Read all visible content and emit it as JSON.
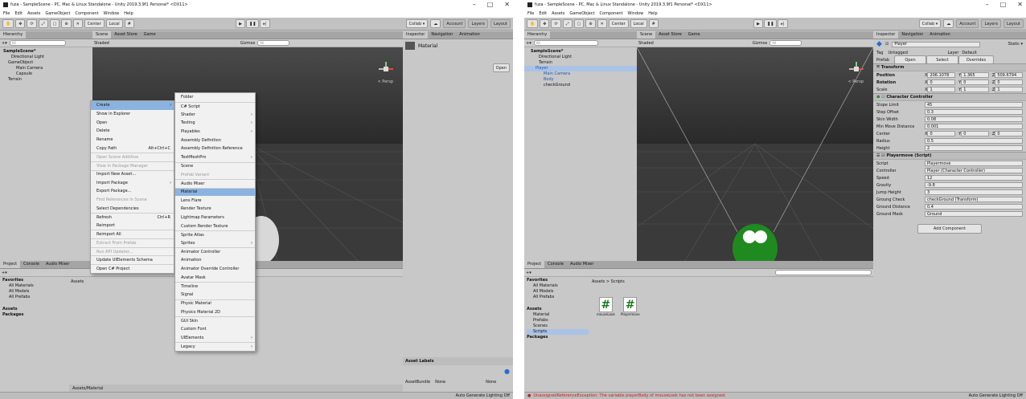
{
  "left": {
    "title": "fuza - SampleScene - PC, Mac & Linux Standalone - Unity 2019.3.9f1 Personal* <DX11>",
    "menu": [
      "File",
      "Edit",
      "Assets",
      "GameObject",
      "Component",
      "Window",
      "Help"
    ],
    "toolbar": {
      "center": "Center",
      "local": "Local",
      "collab": "Collab ▾",
      "account": "Account",
      "layers": "Layers",
      "layout": "Layout"
    },
    "hierarchy": {
      "tab": "Hierarchy",
      "search_placeholder": "All",
      "items": [
        "SampleScene*",
        "Directional Light",
        "GameObject",
        "Main Camera",
        "Capsule",
        "Terrain"
      ]
    },
    "scene": {
      "tabs": [
        "Scene",
        "Asset Store",
        "Game"
      ],
      "shading": "Shaded",
      "gizmos": "Gizmos",
      "search_placeholder": "All",
      "persp": "< Persp"
    },
    "inspector": {
      "tabs": [
        "Inspector",
        "Navigation",
        "Animation"
      ],
      "object_name": "Material",
      "open": "Open"
    },
    "context_menu": [
      {
        "label": "Create",
        "arrow": true,
        "hl": true
      },
      {
        "label": "Show in Explorer"
      },
      {
        "label": "Open"
      },
      {
        "label": "Delete"
      },
      {
        "label": "Rename"
      },
      {
        "label": "Copy Path",
        "shortcut": "Alt+Ctrl+C"
      },
      {
        "label": "Open Scene Additive",
        "dis": true,
        "sep": true
      },
      {
        "label": "View in Package Manager",
        "dis": true,
        "sep": true
      },
      {
        "label": "Import New Asset...",
        "sep": true
      },
      {
        "label": "Import Package",
        "arrow": true
      },
      {
        "label": "Export Package..."
      },
      {
        "label": "Find References In Scene",
        "dis": true
      },
      {
        "label": "Select Dependencies"
      },
      {
        "label": "Refresh",
        "shortcut": "Ctrl+R",
        "sep": true
      },
      {
        "label": "Reimport"
      },
      {
        "label": "Reimport All",
        "sep": true
      },
      {
        "label": "Extract From Prefab",
        "dis": true,
        "sep": true
      },
      {
        "label": "Run API Updater...",
        "dis": true,
        "sep": true
      },
      {
        "label": "Update UIElements Schema",
        "sep": true
      },
      {
        "label": "Open C# Project",
        "sep": true
      }
    ],
    "submenu": [
      {
        "label": "Folder"
      },
      {
        "label": "C# Script",
        "sep": true
      },
      {
        "label": "Shader",
        "arrow": true
      },
      {
        "label": "Testing",
        "arrow": true
      },
      {
        "label": "Playables",
        "arrow": true
      },
      {
        "label": "Assembly Definition"
      },
      {
        "label": "Assembly Definition Reference"
      },
      {
        "label": "TextMeshPro",
        "arrow": true
      },
      {
        "label": "Scene",
        "sep": true
      },
      {
        "label": "Prefab Variant",
        "dis": true
      },
      {
        "label": "Audio Mixer",
        "sep": true
      },
      {
        "label": "Material",
        "hl": true,
        "sep": true
      },
      {
        "label": "Lens Flare"
      },
      {
        "label": "Render Texture"
      },
      {
        "label": "Lightmap Parameters"
      },
      {
        "label": "Custom Render Texture"
      },
      {
        "label": "Sprite Atlas",
        "sep": true
      },
      {
        "label": "Sprites",
        "arrow": true
      },
      {
        "label": "Animator Controller",
        "sep": true
      },
      {
        "label": "Animation"
      },
      {
        "label": "Animator Override Controller"
      },
      {
        "label": "Avatar Mask"
      },
      {
        "label": "Timeline",
        "sep": true
      },
      {
        "label": "Signal"
      },
      {
        "label": "Physic Material",
        "sep": true
      },
      {
        "label": "Physics Material 2D"
      },
      {
        "label": "GUI Skin",
        "sep": true
      },
      {
        "label": "Custom Font"
      },
      {
        "label": "UIElements",
        "arrow": true
      },
      {
        "label": "Legacy",
        "arrow": true,
        "sep": true
      }
    ],
    "project": {
      "tabs": [
        "Project",
        "Console",
        "Audio Mixer"
      ],
      "favorites": "Favorites",
      "fav_items": [
        "All Materials",
        "All Models",
        "All Prefabs"
      ],
      "assets": "Assets",
      "packages": "Packages",
      "crumb": "Assets",
      "path": "Assets/Material"
    },
    "asset_labels": {
      "title": "Asset Labels",
      "bundle_label": "AssetBundle",
      "bundle": "None",
      "variant": "None"
    },
    "status": "Auto Generate Lighting Off"
  },
  "right": {
    "title": "fuza - SampleScene - PC, Mac & Linux Standalone - Unity 2019.3.9f1 Personal* <DX11>",
    "menu": [
      "File",
      "Edit",
      "Assets",
      "GameObject",
      "Component",
      "Window",
      "Help"
    ],
    "toolbar": {
      "center": "Center",
      "local": "Local",
      "collab": "Collab ▾",
      "account": "Account",
      "layers": "Layers",
      "layout": "Layout"
    },
    "hierarchy": {
      "tab": "Hierarchy",
      "search_placeholder": "All",
      "items": [
        "SampleScene*",
        "Directional Light",
        "Terrain",
        "Player",
        "Main Camera",
        "Body",
        "checkGround"
      ]
    },
    "scene": {
      "tabs": [
        "Scene",
        "Asset Store",
        "Game"
      ],
      "shading": "Shaded",
      "gizmos": "Gizmos",
      "search_placeholder": "All",
      "persp": "< Persp"
    },
    "inspector": {
      "tabs": [
        "Inspector",
        "Navigation",
        "Animation"
      ],
      "name": "Player",
      "static": "Static ▾",
      "tag_label": "Tag",
      "tag": "Untagged",
      "layer_label": "Layer",
      "layer": "Default",
      "prefab_label": "Prefab",
      "prefab_open": "Open",
      "prefab_select": "Select",
      "prefab_overrides": "Overrides",
      "transform": {
        "title": "Transform",
        "position": {
          "label": "Position",
          "x": "206.1078",
          "y": "1.365",
          "z": "509.6794"
        },
        "rotation": {
          "label": "Rotation",
          "x": "0",
          "y": "0",
          "z": "0"
        },
        "scale": {
          "label": "Scale",
          "x": "1",
          "y": "1",
          "z": "1"
        }
      },
      "cc": {
        "title": "Character Controller",
        "rows": [
          {
            "label": "Slope Limit",
            "value": "45"
          },
          {
            "label": "Step Offset",
            "value": "0.3"
          },
          {
            "label": "Skin Width",
            "value": "0.08"
          },
          {
            "label": "Min Move Distance",
            "value": "0.001"
          }
        ],
        "center": {
          "label": "Center",
          "x": "0",
          "y": "0",
          "z": "0"
        },
        "radius": {
          "label": "Radius",
          "value": "0.5"
        },
        "height": {
          "label": "Height",
          "value": "2"
        }
      },
      "pm": {
        "title": "Playermove (Script)",
        "rows": [
          {
            "label": "Script",
            "value": "Playermove"
          },
          {
            "label": "Controller",
            "value": "Player (Character Controller)"
          },
          {
            "label": "Speed",
            "value": "12"
          },
          {
            "label": "Gravity",
            "value": "-9.8"
          },
          {
            "label": "Jump Height",
            "value": "3"
          },
          {
            "label": "Groung Check",
            "value": "checkGround (Transform)"
          },
          {
            "label": "Ground Distance",
            "value": "0.4"
          },
          {
            "label": "Ground Mask",
            "value": "Ground"
          }
        ]
      },
      "add_component": "Add Component"
    },
    "project": {
      "tabs": [
        "Project",
        "Console",
        "Audio Mixer"
      ],
      "favorites": "Favorites",
      "fav_items": [
        "All Materials",
        "All Models",
        "All Prefabs"
      ],
      "assets": "Assets",
      "asset_folders": [
        "Material",
        "Prefabs",
        "Scenes",
        "Scripts"
      ],
      "packages": "Packages",
      "crumb": "Assets > Scripts",
      "files": [
        "mouseLook",
        "Playermove"
      ]
    },
    "error": "UnassignedReferenceException: The variable playerBody of mouseLook has not been assigned.",
    "status": "Auto Generate Lighting Off"
  }
}
